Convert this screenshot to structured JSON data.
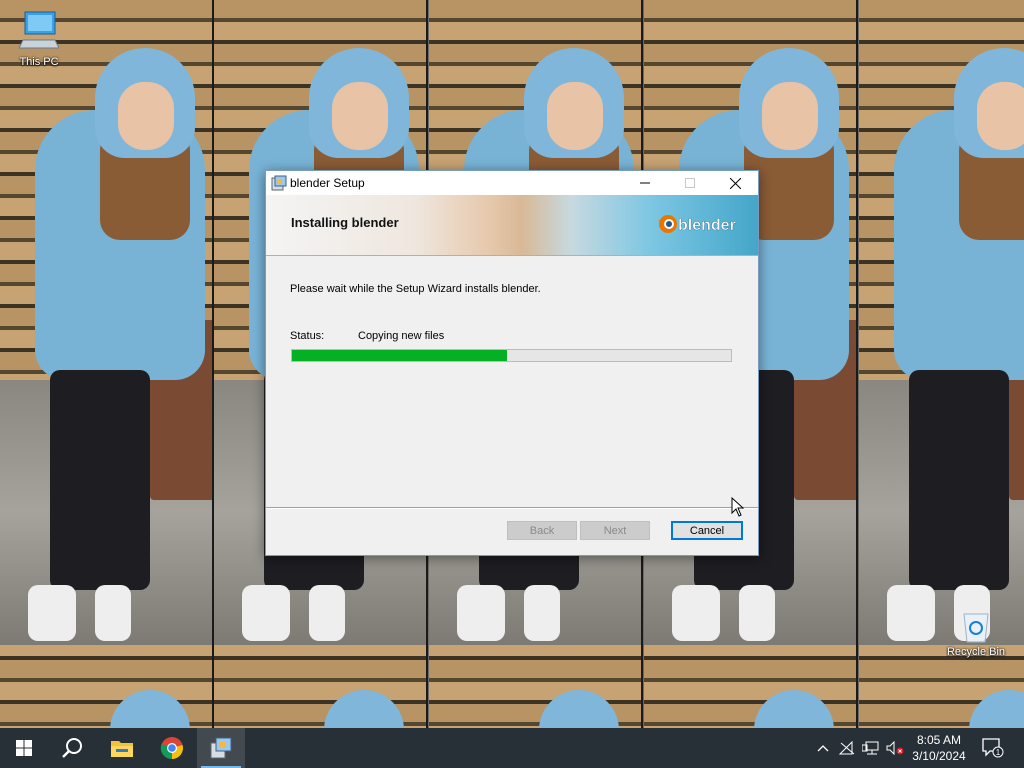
{
  "desktop": {
    "icons": [
      {
        "label": "This PC",
        "icon": "computer-icon"
      },
      {
        "label": "Recycle Bin",
        "icon": "recycle-bin-icon"
      }
    ]
  },
  "window": {
    "title": "blender Setup",
    "banner_heading": "Installing blender",
    "logo_text": "blender",
    "message": "Please wait while the Setup Wizard installs blender.",
    "status_label": "Status:",
    "status_value": "Copying new files",
    "progress_fraction": 0.49,
    "buttons": {
      "back": "Back",
      "next": "Next",
      "cancel": "Cancel"
    }
  },
  "taskbar": {
    "apps": [
      "start-icon",
      "search-icon",
      "file-explorer-icon",
      "chrome-icon",
      "setup-installer-icon"
    ],
    "time": "8:05 AM",
    "date": "3/10/2024",
    "notification_count": "1"
  },
  "colors": {
    "progress_fill": "#06b025",
    "accent": "#0078d7",
    "taskbar": "#161e26"
  }
}
